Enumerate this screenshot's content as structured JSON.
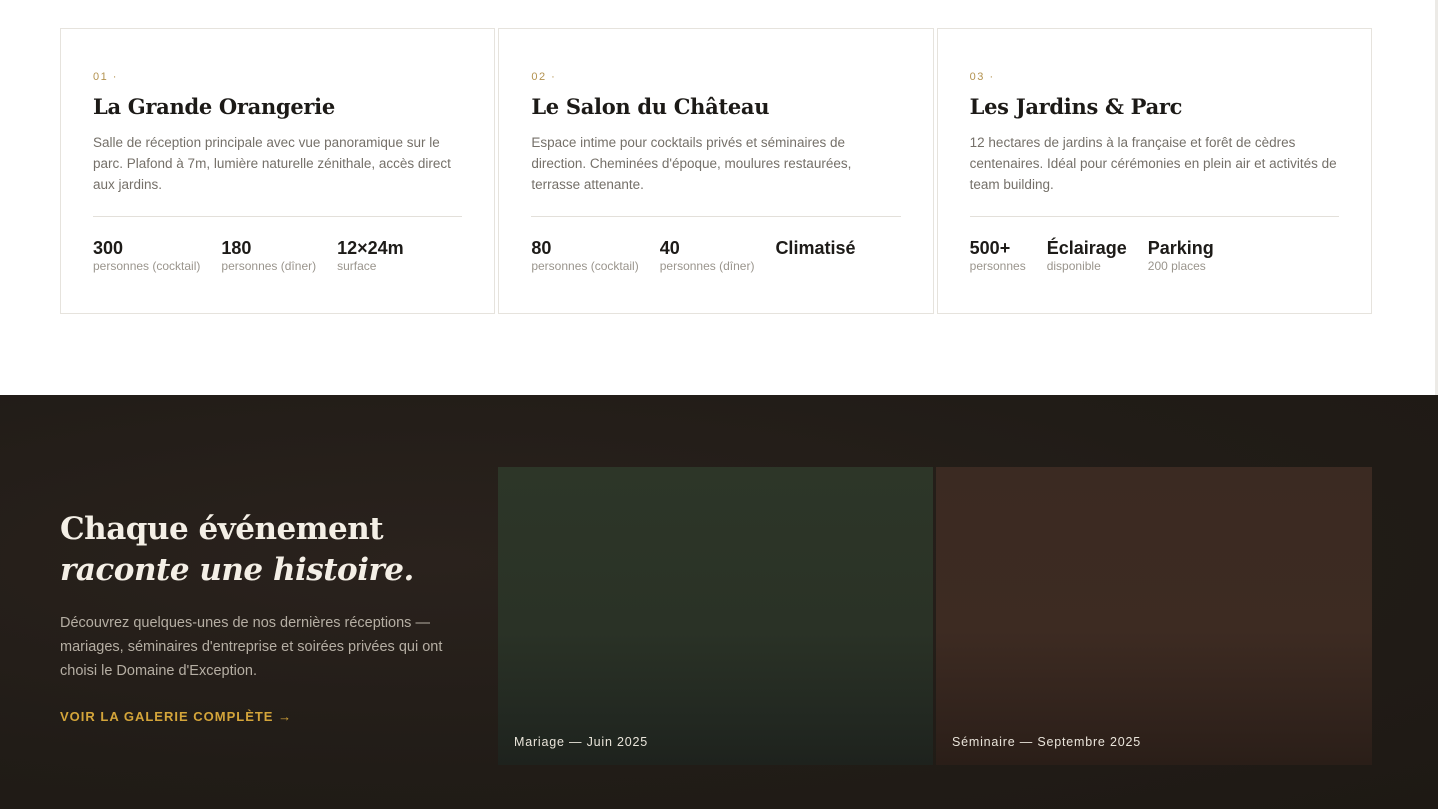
{
  "venues": [
    {
      "number": "01 ·",
      "title": "La Grande Orangerie",
      "description": "Salle de réception principale avec vue panoramique sur le parc. Plafond à 7m, lumière naturelle zénithale, accès direct aux jardins.",
      "stats": [
        {
          "value": "300",
          "label": "personnes (cocktail)"
        },
        {
          "value": "180",
          "label": "personnes (dîner)"
        },
        {
          "value": "12×24m",
          "label": "surface"
        }
      ]
    },
    {
      "number": "02 ·",
      "title": "Le Salon du Château",
      "description": "Espace intime pour cocktails privés et séminaires de direction. Cheminées d'époque, moulures restaurées, terrasse attenante.",
      "stats": [
        {
          "value": "80",
          "label": "personnes (cocktail)"
        },
        {
          "value": "40",
          "label": "personnes (dîner)"
        },
        {
          "value": "Climatisé",
          "label": ""
        }
      ]
    },
    {
      "number": "03 ·",
      "title": "Les Jardins & Parc",
      "description": "12 hectares de jardins à la française et forêt de cèdres centenaires. Idéal pour cérémonies en plein air et activités de team building.",
      "stats": [
        {
          "value": "500+",
          "label": "personnes"
        },
        {
          "value": "Éclairage",
          "label": "disponible"
        },
        {
          "value": "Parking",
          "label": "200 places"
        }
      ]
    }
  ],
  "stories": {
    "headline_line1": "Chaque événement",
    "headline_line2": "raconte une histoire.",
    "intro": "Découvrez quelques-unes de nos dernières réceptions — mariages, séminaires d'entreprise et soirées privées qui ont choisi le Domaine d'Exception.",
    "gallery_link": "VOIR LA GALERIE COMPLÈTE →",
    "tiles": [
      {
        "caption": "Mariage — Juin 2025"
      },
      {
        "caption": "Séminaire — Septembre 2025"
      }
    ]
  },
  "colors": {
    "accent_gold": "#d4a53a",
    "dark_bg": "#211c17",
    "tile_green": "#2d3628",
    "tile_brown": "#3d2b22"
  }
}
